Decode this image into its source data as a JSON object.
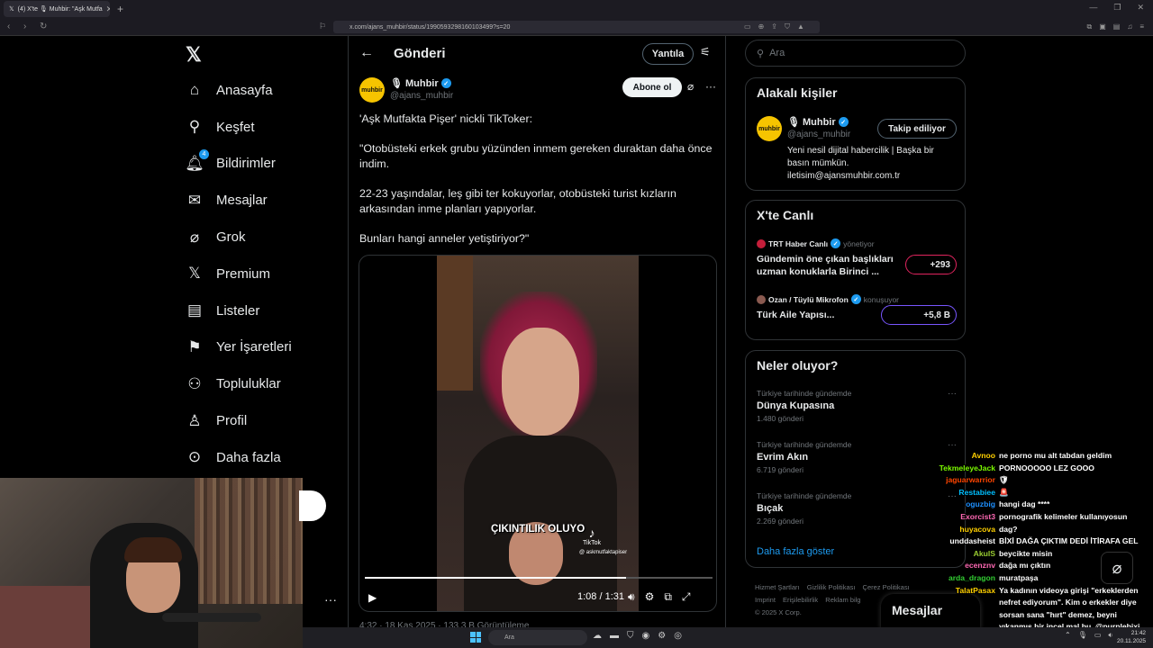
{
  "browser": {
    "tab_title": "(4) X'te 🎙 Muhbir: \"Aşk Mutfa",
    "url": "x.com/ajans_muhbir/status/1990593298160103499?s=20"
  },
  "nav": {
    "items": [
      {
        "label": "Anasayfa",
        "icon": "home-icon"
      },
      {
        "label": "Keşfet",
        "icon": "search-icon"
      },
      {
        "label": "Bildirimler",
        "icon": "bell-icon",
        "badge": "4"
      },
      {
        "label": "Mesajlar",
        "icon": "mail-icon"
      },
      {
        "label": "Grok",
        "icon": "grok-icon"
      },
      {
        "label": "Premium",
        "icon": "x-icon"
      },
      {
        "label": "Listeler",
        "icon": "list-icon"
      },
      {
        "label": "Yer İşaretleri",
        "icon": "bookmark-icon"
      },
      {
        "label": "Topluluklar",
        "icon": "communities-icon"
      },
      {
        "label": "Profil",
        "icon": "profile-icon"
      },
      {
        "label": "Daha fazla",
        "icon": "more-icon"
      }
    ]
  },
  "post": {
    "header_title": "Gönderi",
    "reply_label": "Yantıla",
    "author_name": "Muhbir",
    "author_handle": "@ajans_muhbir",
    "avatar_text": "muhbir",
    "follow_label": "Abone ol",
    "paragraphs": [
      "'Aşk Mutfakta Pişer' nickli TikToker:",
      "\"Otobüsteki erkek grubu yüzünden inmem gereken duraktan daha önce indim.",
      "22-23 yaşındalar, leş gibi ter kokuyorlar, otobüsteki turist kızların arkasından inme planları yapıyorlar.",
      "Bunları hangi anneler yetiştiriyor?\""
    ],
    "video": {
      "caption": "ÇIKINTILIK OLUYO",
      "tiktok_label": "TikTok",
      "tiktok_user": "@ askmutfaktapiser",
      "time": "1:08 / 1:31",
      "progress": 0.75
    },
    "meta": "4:32 · 18 Kas 2025 · 133,3 B Görüntüleme"
  },
  "sidebar": {
    "search_placeholder": "Ara",
    "related": {
      "title": "Alakalı kişiler",
      "name": "Muhbir",
      "handle": "@ajans_muhbir",
      "avatar_text": "muhbir",
      "follow_label": "Takip ediliyor",
      "bio": "Yeni nesil dijital habercilik | Başka bir basın mümkün. iletisim@ajansmuhbir.com.tr"
    },
    "live": {
      "title": "X'te Canlı",
      "items": [
        {
          "host": "TRT Haber Canlı",
          "role": "yönetiyor",
          "title": "Gündemin öne çıkan başlıkları uzman konuklarla Birinci ...",
          "count": "+293"
        },
        {
          "host": "Ozan / Tüylü Mikrofon",
          "role": "konuşuyor",
          "title": "Türk Aile Yapısı...",
          "count": "+5,8 B"
        }
      ]
    },
    "trends": {
      "title": "Neler oluyor?",
      "items": [
        {
          "context": "Türkiye tarihinde gündemde",
          "name": "Dünya Kupasına",
          "count": "1.480 gönderi"
        },
        {
          "context": "Türkiye tarihinde gündemde",
          "name": "Evrim Akın",
          "count": "6.719 gönderi"
        },
        {
          "context": "Türkiye tarihinde gündemde",
          "name": "Bıçak",
          "count": "2.269 gönderi"
        }
      ],
      "show_more": "Daha fazla göster"
    },
    "footer": [
      "Hizmet Şartları",
      "Gizlilik Politikası",
      "Çerez Politikası",
      "Imprint",
      "Erişilebilirlik",
      "Reklam bilg",
      "© 2025 X Corp."
    ]
  },
  "chat": [
    {
      "user": "Avnoo",
      "color": "#ffd000",
      "msg": "ne porno mu alt tabdan geldim"
    },
    {
      "user": "TekmeleyeJack",
      "color": "#7cfc00",
      "msg": "PORNOOOOO LEZ GOOO"
    },
    {
      "user": "jaguarwarrior",
      "color": "#ff4500",
      "msg": "🛡"
    },
    {
      "user": "Restabiee",
      "color": "#00bfff",
      "msg": "🚨"
    },
    {
      "user": "oguzbig",
      "color": "#1e90ff",
      "msg": "hangi dag ****"
    },
    {
      "user": "Exorcist3",
      "color": "#ff69b4",
      "msg": "pornografik kelimeler kullanıyosun"
    },
    {
      "user": "huyacova",
      "color": "#ffd000",
      "msg": "dag?"
    },
    {
      "user": "unddasheist",
      "color": "#ffffff",
      "msg": "BİXİ DAĞA ÇIKTIM DEDİ İTİRAFA GEL"
    },
    {
      "user": "AkulS",
      "color": "#9acd32",
      "msg": "beycikte misin"
    },
    {
      "user": "ecenznv",
      "color": "#ff69b4",
      "msg": "dağa mı çıktın"
    },
    {
      "user": "arda_dragon",
      "color": "#32cd32",
      "msg": "muratpaşa"
    },
    {
      "user": "TalatPasax",
      "color": "#ffd000",
      "msg": "Ya kadının videoya girişi \"erkeklerden nefret ediyorum\". Kim o erkekler diye sorsan sana \"hırt\" demez, beyni yıkanmış bir incel mal bu. @purplebixi"
    }
  ],
  "dm_drawer": {
    "label": "Mesajlar"
  },
  "taskbar": {
    "search": "Ara",
    "time": "21:42",
    "date": "20.11.2025"
  }
}
